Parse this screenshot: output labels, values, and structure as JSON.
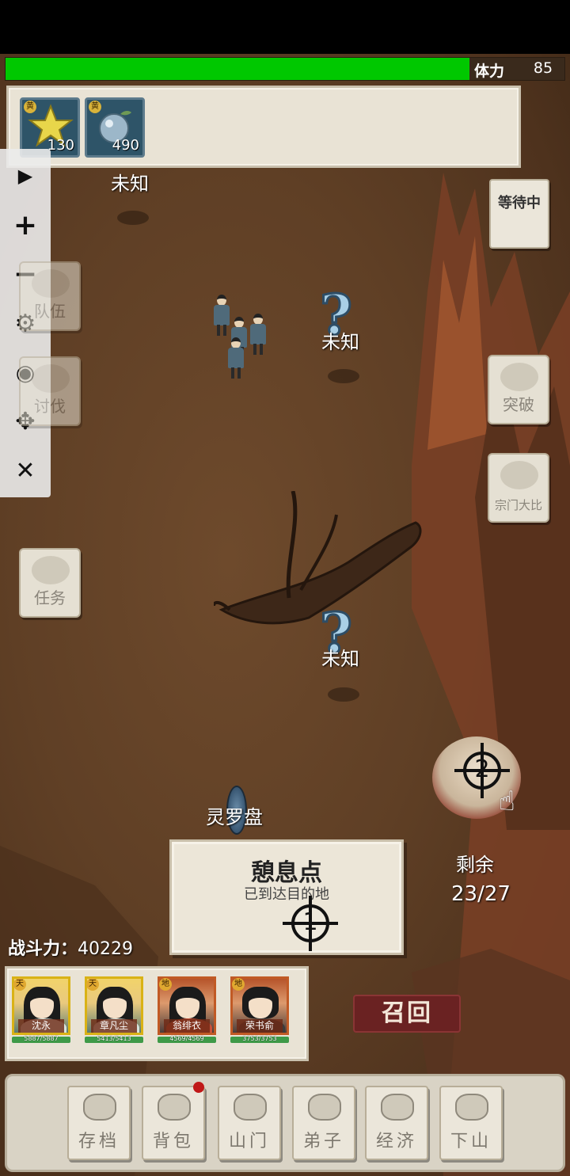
{
  "stamina": {
    "label": "体力",
    "value": "85",
    "fraction": 0.83
  },
  "resources": [
    {
      "name": "star-fruit",
      "grade": "黄",
      "count": "130"
    },
    {
      "name": "spirit-berry",
      "grade": "黄",
      "count": "490"
    }
  ],
  "toolbar": {
    "play": "▶",
    "zoom_in": "+",
    "zoom_out": "−",
    "settings": "⚙",
    "hide": "◉",
    "move": "✥",
    "close": "✕"
  },
  "side_buttons": {
    "team": "队伍",
    "crusade": "讨伐",
    "quest": "任务",
    "waiting": "等待中",
    "breakthrough": "突破",
    "sect_contest": "宗门大比"
  },
  "markers": {
    "unknown_1": "未知",
    "unknown_2": "未知",
    "unknown_3": "未知",
    "qmark": "?",
    "compass": "灵罗盘"
  },
  "destination": {
    "title": "憩息点",
    "subtitle": "已到达目的地",
    "target_number": "1"
  },
  "locate": {
    "number": "2",
    "hand_icon": "☝"
  },
  "remaining": {
    "label": "剩余",
    "value": "23/27"
  },
  "power": {
    "label": "战斗力：",
    "value": "40229"
  },
  "team": [
    {
      "name": "沈永",
      "tier": "天",
      "hp": "5887/5887",
      "frame": "gold"
    },
    {
      "name": "章凡尘",
      "tier": "天",
      "hp": "5413/5413",
      "frame": "gold"
    },
    {
      "name": "翁绯衣",
      "tier": "地",
      "hp": "4569/4569",
      "frame": "red"
    },
    {
      "name": "荣书俞",
      "tier": "地",
      "hp": "3753/3753",
      "frame": "red"
    }
  ],
  "recall": "召回",
  "nav": {
    "save": "存档",
    "bag": "背包",
    "gate": "山门",
    "disciples": "弟子",
    "economy": "经济",
    "descend": "下山"
  },
  "colors": {
    "stamina": "#00c800",
    "recall": "#6a2222",
    "badge": "#c01818"
  }
}
